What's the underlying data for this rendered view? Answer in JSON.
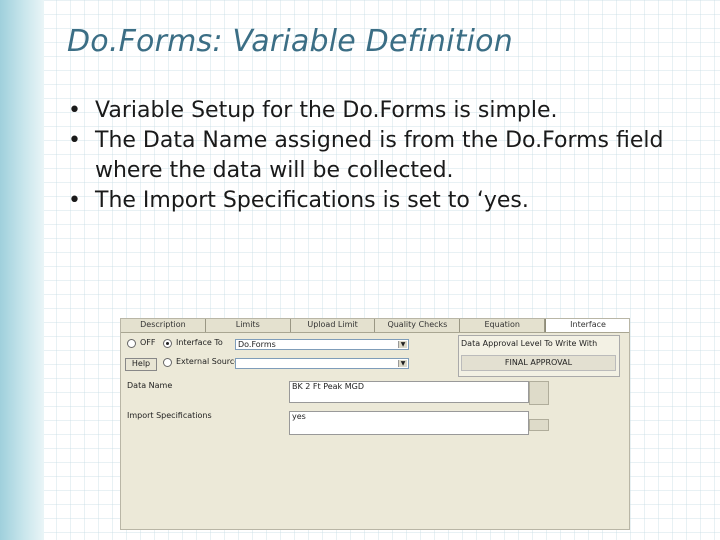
{
  "slide": {
    "title": "Do.Forms: Variable Definition",
    "bullets": [
      "Variable Setup for the Do.Forms is simple.",
      "The Data Name assigned is from the Do.Forms field where the data will be collected.",
      "The Import Specifications is set to ‘yes."
    ],
    "bullet_glyph": "•"
  },
  "screenshot": {
    "tabs": [
      "Description",
      "Limits",
      "Upload Limit",
      "Quality Checks",
      "Equation",
      "Interface"
    ],
    "active_tab": "Interface",
    "radio_off_label": "OFF",
    "radio_interface_label": "Interface To",
    "radio_external_label": "External Source",
    "interface_to_value": "Do.Forms",
    "help_button": "Help",
    "approval_label": "Data Approval Level To Write With",
    "approval_value": "FINAL APPROVAL",
    "data_name_label": "Data Name",
    "data_name_value": "BK 2 Ft Peak MGD",
    "import_spec_label": "Import Specifications",
    "import_spec_value": "yes"
  }
}
